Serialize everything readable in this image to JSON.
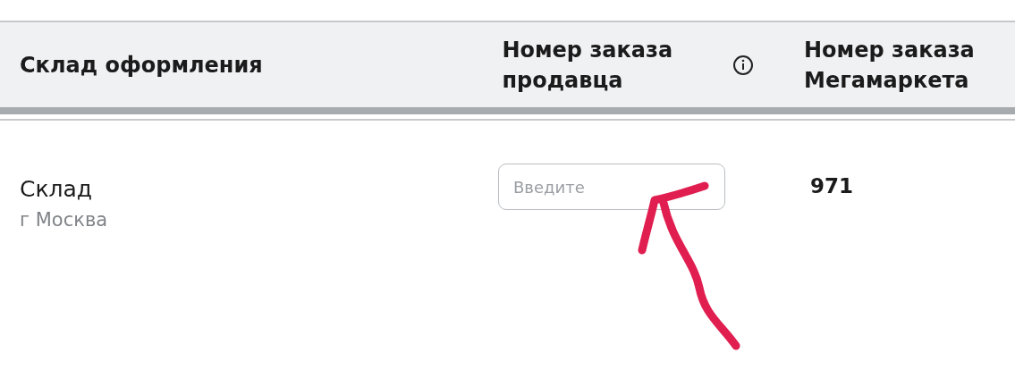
{
  "table": {
    "columns": [
      {
        "label": "Склад оформления",
        "info": false
      },
      {
        "label": "Номер заказа продавца",
        "info": true
      },
      {
        "label": "Номер заказа Мегамаркета",
        "info": false
      }
    ],
    "rows": [
      {
        "warehouse": "Склад",
        "city": "г Москва",
        "seller_order": {
          "placeholder": "Введите"
        },
        "order_number": "971"
      }
    ]
  },
  "annotation": {
    "kind": "arrow"
  }
}
